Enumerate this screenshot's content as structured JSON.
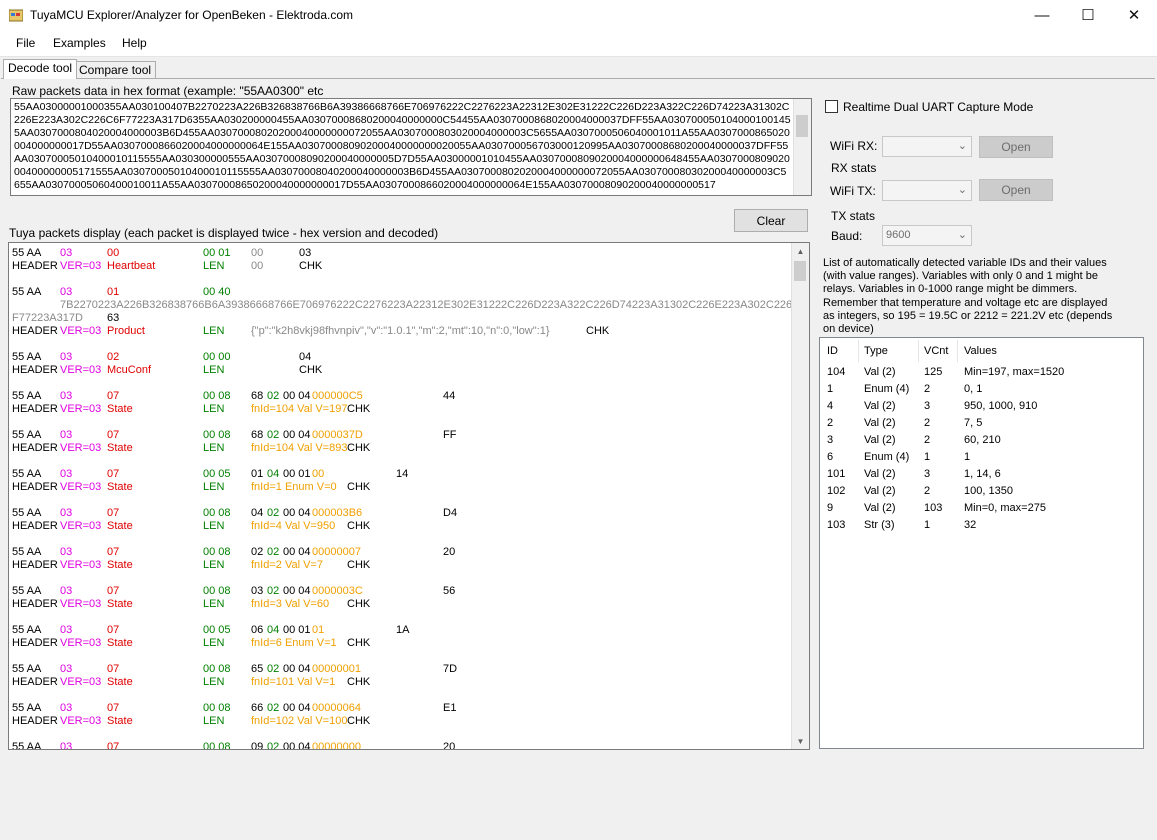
{
  "window": {
    "title": "TuyaMCU Explorer/Analyzer for OpenBeken - Elektroda.com"
  },
  "menu": [
    "File",
    "Examples",
    "Help"
  ],
  "tabs": [
    "Decode tool",
    "Compare tool"
  ],
  "raw": {
    "label": "Raw packets data in hex format (example: \"55AA0300\" etc",
    "text": "55AA03000001000355AA030100407B2270223A226B326838766B6A39386668766E706976222C2276223A22312E302E31222C226D223A322C226D74223A31302C226E223A302C226C6F77223A317D6355AA030200000455AA03070008680200040000000C54455AA0307000868020004000037DFF55AA0307000501040001001455AA0307000804020004000003B6D455AA03070008020200040000000072055AA0307000803020004000003C5655AA0307000506040001011A55AA0307000865020004000000017D55AA0307000866020004000000064E155AA03070008090200040000000020055AA030700056703000120995AA03070008680200040000037DFF55AA03070005010400010115555AA030300000555AA03070008090200040000005D7D55AA03000001010455AA0307000809020004000000648455AA030700080902000400000005171555AA03070005010400010115555AA03070008040200040000003B6D455AA0307000802020004000000072055AA03070008030200040000003C5655AA03070005060400010011A55AA03070008650200040000000017D55AA0307000866020004000000064E155AA03070008090200040000000517"
  },
  "clear_label": "Clear",
  "packets_label": "Tuya packets display (each packet is displayed twice - hex version and decoded)",
  "packets": [
    {
      "hdr": "55 AA",
      "ver": "03",
      "cmd": "00",
      "len": "00 01",
      "data": "00",
      "chk": "03",
      "name": "Heartbeat",
      "dec": "00"
    },
    {
      "hdr": "55 AA",
      "ver": "03",
      "cmd": "01",
      "len": "00 40",
      "data": "7B2270223A226B326838766B6A39386668766E706976222C2276223A22312E302E31222C226D223A322C226D74223A31302C226E223A302C226C6",
      "data2": "F77223A317D",
      "chk": "63",
      "name": "Product",
      "dec": "{\"p\":\"k2h8vkj98fhvnpiv\",\"v\":\"1.0.1\",\"m\":2,\"mt\":10,\"n\":0,\"low\":1}"
    },
    {
      "hdr": "55 AA",
      "ver": "03",
      "cmd": "02",
      "len": "00 00",
      "data": "",
      "chk": "04",
      "name": "McuConf",
      "dec": ""
    },
    {
      "hdr": "55 AA",
      "ver": "03",
      "cmd": "07",
      "len": "00 08",
      "data_a": "68",
      "data_b": "02",
      "data_c": "00 04",
      "data_d": "000000C5",
      "chk": "44",
      "name": "State",
      "dec": "fnId=104 Val V=197"
    },
    {
      "hdr": "55 AA",
      "ver": "03",
      "cmd": "07",
      "len": "00 08",
      "data_a": "68",
      "data_b": "02",
      "data_c": "00 04",
      "data_d": "0000037D",
      "chk": "FF",
      "name": "State",
      "dec": "fnId=104 Val V=893"
    },
    {
      "hdr": "55 AA",
      "ver": "03",
      "cmd": "07",
      "len": "00 05",
      "data_a": "01",
      "data_b": "04",
      "data_c": "00 01",
      "data_d": "00",
      "chk": "14",
      "name": "State",
      "dec": "fnId=1 Enum V=0"
    },
    {
      "hdr": "55 AA",
      "ver": "03",
      "cmd": "07",
      "len": "00 08",
      "data_a": "04",
      "data_b": "02",
      "data_c": "00 04",
      "data_d": "000003B6",
      "chk": "D4",
      "name": "State",
      "dec": "fnId=4 Val V=950"
    },
    {
      "hdr": "55 AA",
      "ver": "03",
      "cmd": "07",
      "len": "00 08",
      "data_a": "02",
      "data_b": "02",
      "data_c": "00 04",
      "data_d": "00000007",
      "chk": "20",
      "name": "State",
      "dec": "fnId=2 Val V=7"
    },
    {
      "hdr": "55 AA",
      "ver": "03",
      "cmd": "07",
      "len": "00 08",
      "data_a": "03",
      "data_b": "02",
      "data_c": "00 04",
      "data_d": "0000003C",
      "chk": "56",
      "name": "State",
      "dec": "fnId=3 Val V=60"
    },
    {
      "hdr": "55 AA",
      "ver": "03",
      "cmd": "07",
      "len": "00 05",
      "data_a": "06",
      "data_b": "04",
      "data_c": "00 01",
      "data_d": "01",
      "chk": "1A",
      "name": "State",
      "dec": "fnId=6 Enum V=1"
    },
    {
      "hdr": "55 AA",
      "ver": "03",
      "cmd": "07",
      "len": "00 08",
      "data_a": "65",
      "data_b": "02",
      "data_c": "00 04",
      "data_d": "00000001",
      "chk": "7D",
      "name": "State",
      "dec": "fnId=101 Val V=1"
    },
    {
      "hdr": "55 AA",
      "ver": "03",
      "cmd": "07",
      "len": "00 08",
      "data_a": "66",
      "data_b": "02",
      "data_c": "00 04",
      "data_d": "00000064",
      "chk": "E1",
      "name": "State",
      "dec": "fnId=102 Val V=100"
    },
    {
      "hdr": "55 AA",
      "ver": "03",
      "cmd": "07",
      "len": "00 08",
      "data_a": "09",
      "data_b": "02",
      "data_c": "00 04",
      "data_d": "00000000",
      "chk": "20",
      "name": "",
      "dec": ""
    }
  ],
  "decoded_labels": {
    "header": "HEADER",
    "ver_prefix": "VER=",
    "len": "LEN",
    "chk": "CHK"
  },
  "right": {
    "capture_label": "Realtime Dual UART Capture Mode",
    "wifi_rx": "WiFi RX:",
    "rx_stats": "RX stats",
    "wifi_tx": "WiFi TX:",
    "tx_stats": "TX stats",
    "baud": "Baud:",
    "baud_value": "9600",
    "open_label": "Open",
    "info": [
      "List of automatically detected variable IDs  and their values",
      "(with value ranges). Variables with only 0 and 1 might be",
      "relays. Variables in 0-1000 range might be dimmers.",
      "Remember that temperature and voltage etc are displayed",
      "as integers, so 195 = 19.5C or 2212 = 221.2V etc (depends",
      "on device)"
    ]
  },
  "vars": {
    "columns": [
      "ID",
      "Type",
      "VCnt",
      "Values"
    ],
    "rows": [
      [
        "104",
        "Val (2)",
        "125",
        "Min=197, max=1520"
      ],
      [
        "1",
        "Enum (4)",
        "2",
        "0, 1"
      ],
      [
        "4",
        "Val (2)",
        "3",
        "950, 1000, 910"
      ],
      [
        "2",
        "Val (2)",
        "2",
        "7, 5"
      ],
      [
        "3",
        "Val (2)",
        "2",
        "60, 210"
      ],
      [
        "6",
        "Enum (4)",
        "1",
        "1"
      ],
      [
        "101",
        "Val (2)",
        "3",
        "1, 14, 6"
      ],
      [
        "102",
        "Val (2)",
        "2",
        "100, 1350"
      ],
      [
        "9",
        "Val (2)",
        "103",
        "Min=0, max=275"
      ],
      [
        "103",
        "Str (3)",
        "1",
        "32"
      ]
    ]
  }
}
